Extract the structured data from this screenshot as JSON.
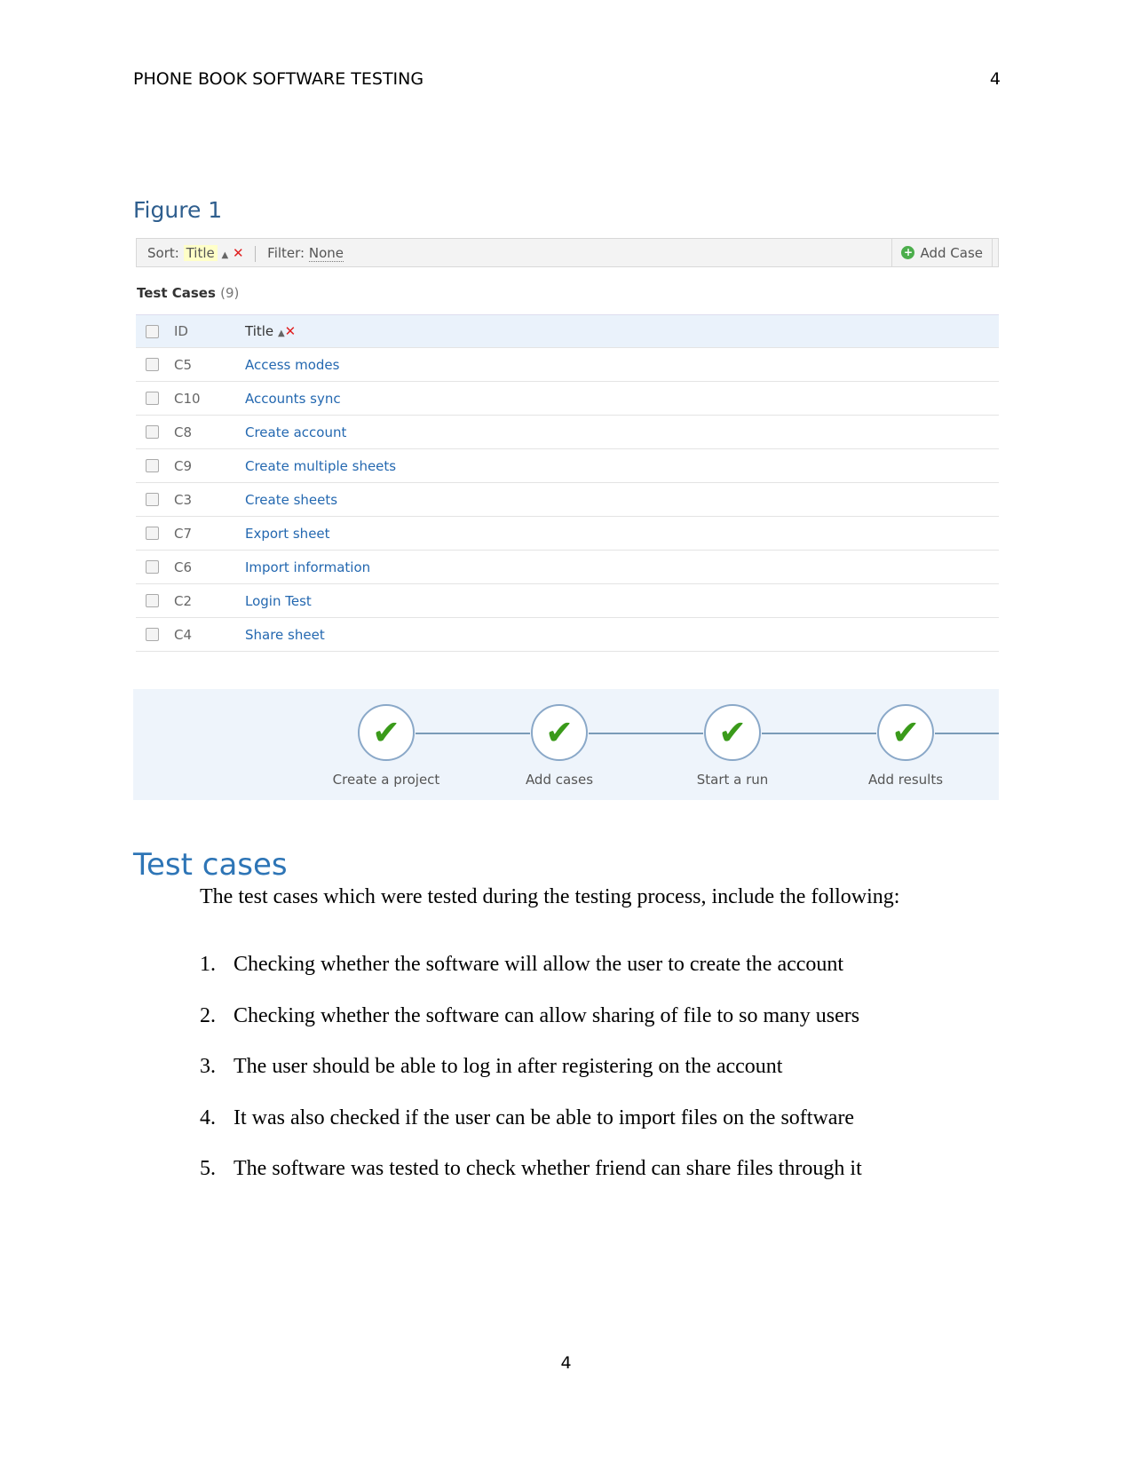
{
  "header": {
    "running_title": "PHONE BOOK SOFTWARE TESTING",
    "page_number": "4"
  },
  "figure": {
    "label": "Figure 1",
    "toolbar": {
      "sort_label": "Sort:",
      "sort_value": "Title",
      "filter_label": "Filter:",
      "filter_value": "None",
      "add_case": "Add Case"
    },
    "section_title": "Test Cases",
    "count": "(9)",
    "columns": {
      "id": "ID",
      "title": "Title"
    },
    "rows": [
      {
        "id": "C5",
        "title": "Access modes"
      },
      {
        "id": "C10",
        "title": "Accounts sync"
      },
      {
        "id": "C8",
        "title": "Create account"
      },
      {
        "id": "C9",
        "title": "Create multiple sheets"
      },
      {
        "id": "C3",
        "title": "Create sheets"
      },
      {
        "id": "C7",
        "title": "Export sheet"
      },
      {
        "id": "C6",
        "title": "Import information"
      },
      {
        "id": "C2",
        "title": "Login Test"
      },
      {
        "id": "C4",
        "title": "Share sheet"
      }
    ],
    "steps": [
      "Create a project",
      "Add cases",
      "Start a run",
      "Add results"
    ],
    "icons": {
      "check": "check-icon",
      "add": "plus-circle-icon"
    }
  },
  "body": {
    "heading": "Test cases",
    "intro": "The test cases which were tested during the testing process, include the following:",
    "items": [
      {
        "n": "1.",
        "text": "Checking whether the software will allow the user to create the account"
      },
      {
        "n": "2.",
        "text": "Checking whether the software can allow sharing of file to so many users"
      },
      {
        "n": "3.",
        "text": "The user should be able to log in after registering on the account"
      },
      {
        "n": "4.",
        "text": "It was also checked if the user can be able to import files on the software"
      },
      {
        "n": "5.",
        "text": "The software was tested to check whether friend can share files through it"
      }
    ]
  },
  "footer": {
    "page_number": "4"
  }
}
